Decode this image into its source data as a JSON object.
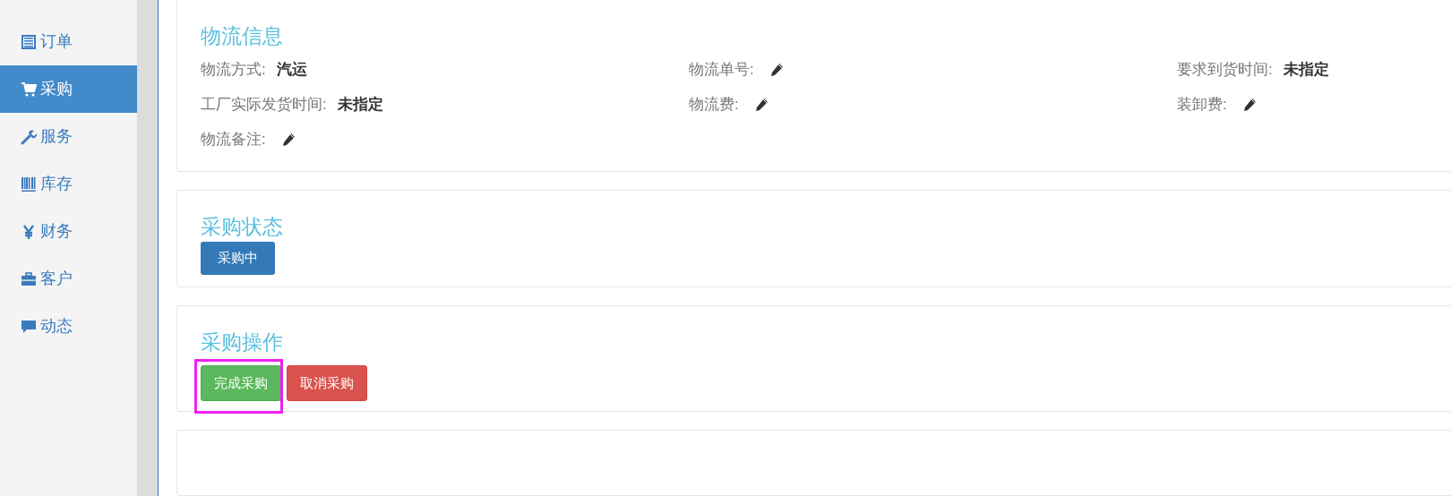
{
  "sidebar": {
    "items": [
      {
        "label": "订单",
        "selected": false
      },
      {
        "label": "采购",
        "selected": true
      },
      {
        "label": "服务",
        "selected": false
      },
      {
        "label": "库存",
        "selected": false
      },
      {
        "label": "财务",
        "selected": false
      },
      {
        "label": "客户",
        "selected": false
      },
      {
        "label": "动态",
        "selected": false
      }
    ]
  },
  "logistics": {
    "title": "物流信息",
    "fields": [
      {
        "label": "物流方式:",
        "kind": "value",
        "value": "汽运"
      },
      {
        "label": "物流单号:",
        "kind": "edit"
      },
      {
        "label": "要求到货时间:",
        "kind": "value",
        "value": "未指定"
      },
      {
        "label": "工厂实际发货时间:",
        "kind": "value",
        "value": "未指定"
      },
      {
        "label": "物流费:",
        "kind": "edit"
      },
      {
        "label": "装卸费:",
        "kind": "edit"
      },
      {
        "label": "物流备注:",
        "kind": "edit"
      }
    ]
  },
  "status": {
    "title": "采购状态",
    "badge": "采购中"
  },
  "actions": {
    "title": "采购操作",
    "buttons": [
      {
        "label": "完成采购",
        "kind": "success",
        "highlighted": true
      },
      {
        "label": "取消采购",
        "kind": "danger",
        "highlighted": false
      }
    ]
  }
}
